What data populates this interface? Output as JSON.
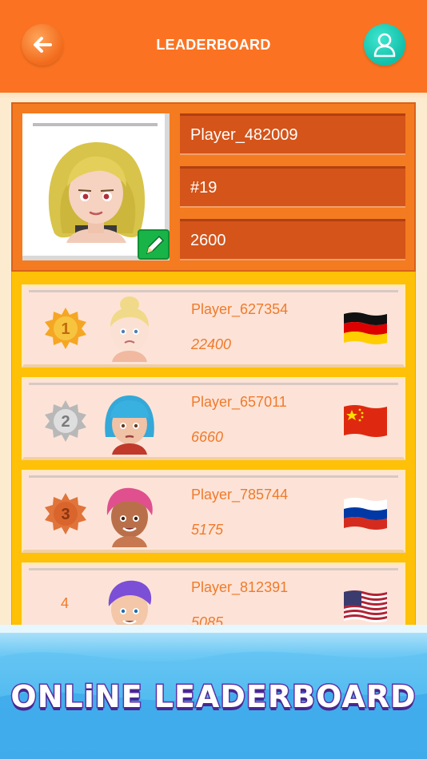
{
  "header": {
    "title": "LEADERBOARD",
    "back_icon": "arrow-left-icon",
    "profile_icon": "user-icon"
  },
  "my_profile": {
    "name": "Player_482009",
    "rank": "#19",
    "score": "2600",
    "edit_icon": "pencil-icon"
  },
  "leaderboard": [
    {
      "rank": "1",
      "name": "Player_627354",
      "score": "22400",
      "medal": "gold",
      "country": "Germany"
    },
    {
      "rank": "2",
      "name": "Player_657011",
      "score": "6660",
      "medal": "silver",
      "country": "China"
    },
    {
      "rank": "3",
      "name": "Player_785744",
      "score": "5175",
      "medal": "bronze",
      "country": "Russia"
    },
    {
      "rank": "4",
      "name": "Player_812391",
      "score": "5085",
      "medal": "none",
      "country": "United States"
    }
  ],
  "banner": {
    "text": "ONLiNE LEADERBOARD"
  },
  "colors": {
    "header": "#fb7322",
    "board": "#ffc107",
    "accent_text": "#f07a2b",
    "banner_stroke": "#5b34a8"
  }
}
